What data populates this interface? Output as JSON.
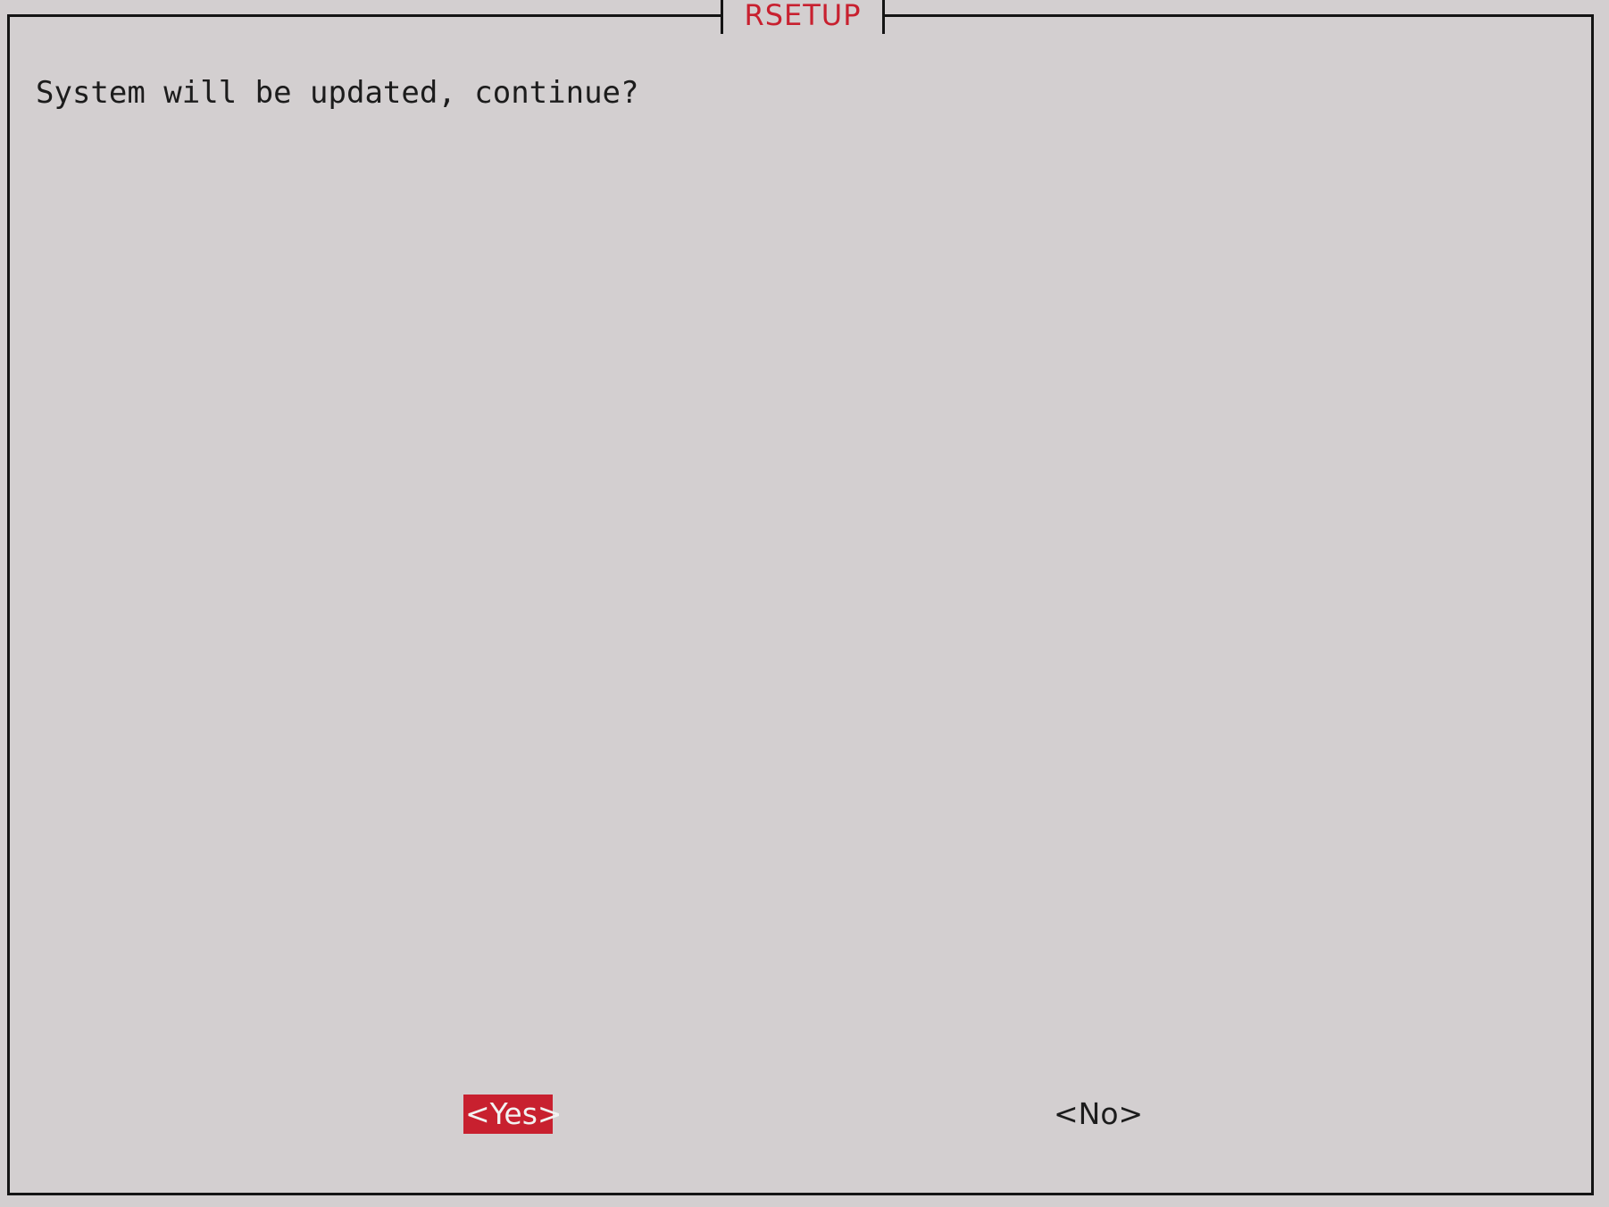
{
  "dialog": {
    "title": "RSETUP",
    "message": "System will be updated, continue?",
    "buttons": {
      "yes_label": "<Yes>",
      "no_label": "<No>",
      "selected": "yes"
    }
  },
  "colors": {
    "background": "#d3cfd0",
    "accent": "#c8202f",
    "frame": "#141414",
    "text": "#1c1c1c"
  }
}
